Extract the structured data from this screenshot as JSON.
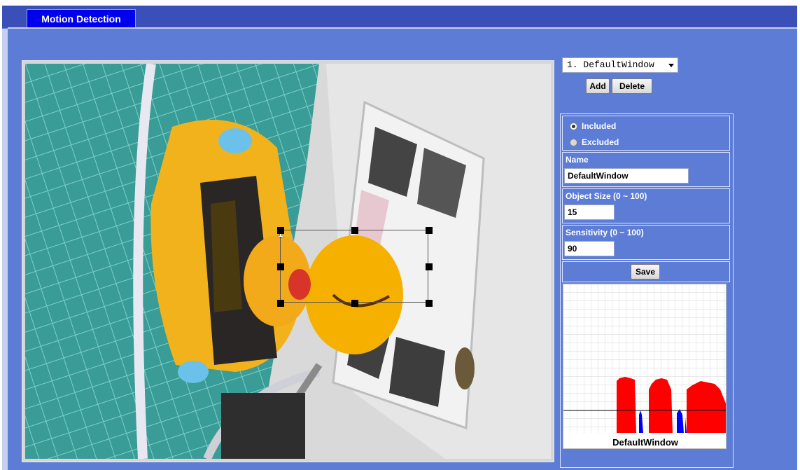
{
  "header": {
    "tab_label": "Motion Detection"
  },
  "window_select": {
    "selected": "1. DefaultWindow"
  },
  "buttons": {
    "add": "Add",
    "delete": "Delete",
    "save": "Save"
  },
  "settings": {
    "included_label": "Included",
    "excluded_label": "Excluded",
    "mode": "Included",
    "name_label": "Name",
    "name_value": "DefaultWindow",
    "object_size_label": "Object Size  (0 ~ 100)",
    "object_size_value": "15",
    "sensitivity_label": "Sensitivity  (0 ~ 100)",
    "sensitivity_value": "90"
  },
  "video": {
    "window_index": "1"
  },
  "graph": {
    "label": "DefaultWindow",
    "colors": {
      "activity": "#ff0000",
      "motion": "#0000ff",
      "threshold": "#000000"
    },
    "threshold_line": true
  }
}
